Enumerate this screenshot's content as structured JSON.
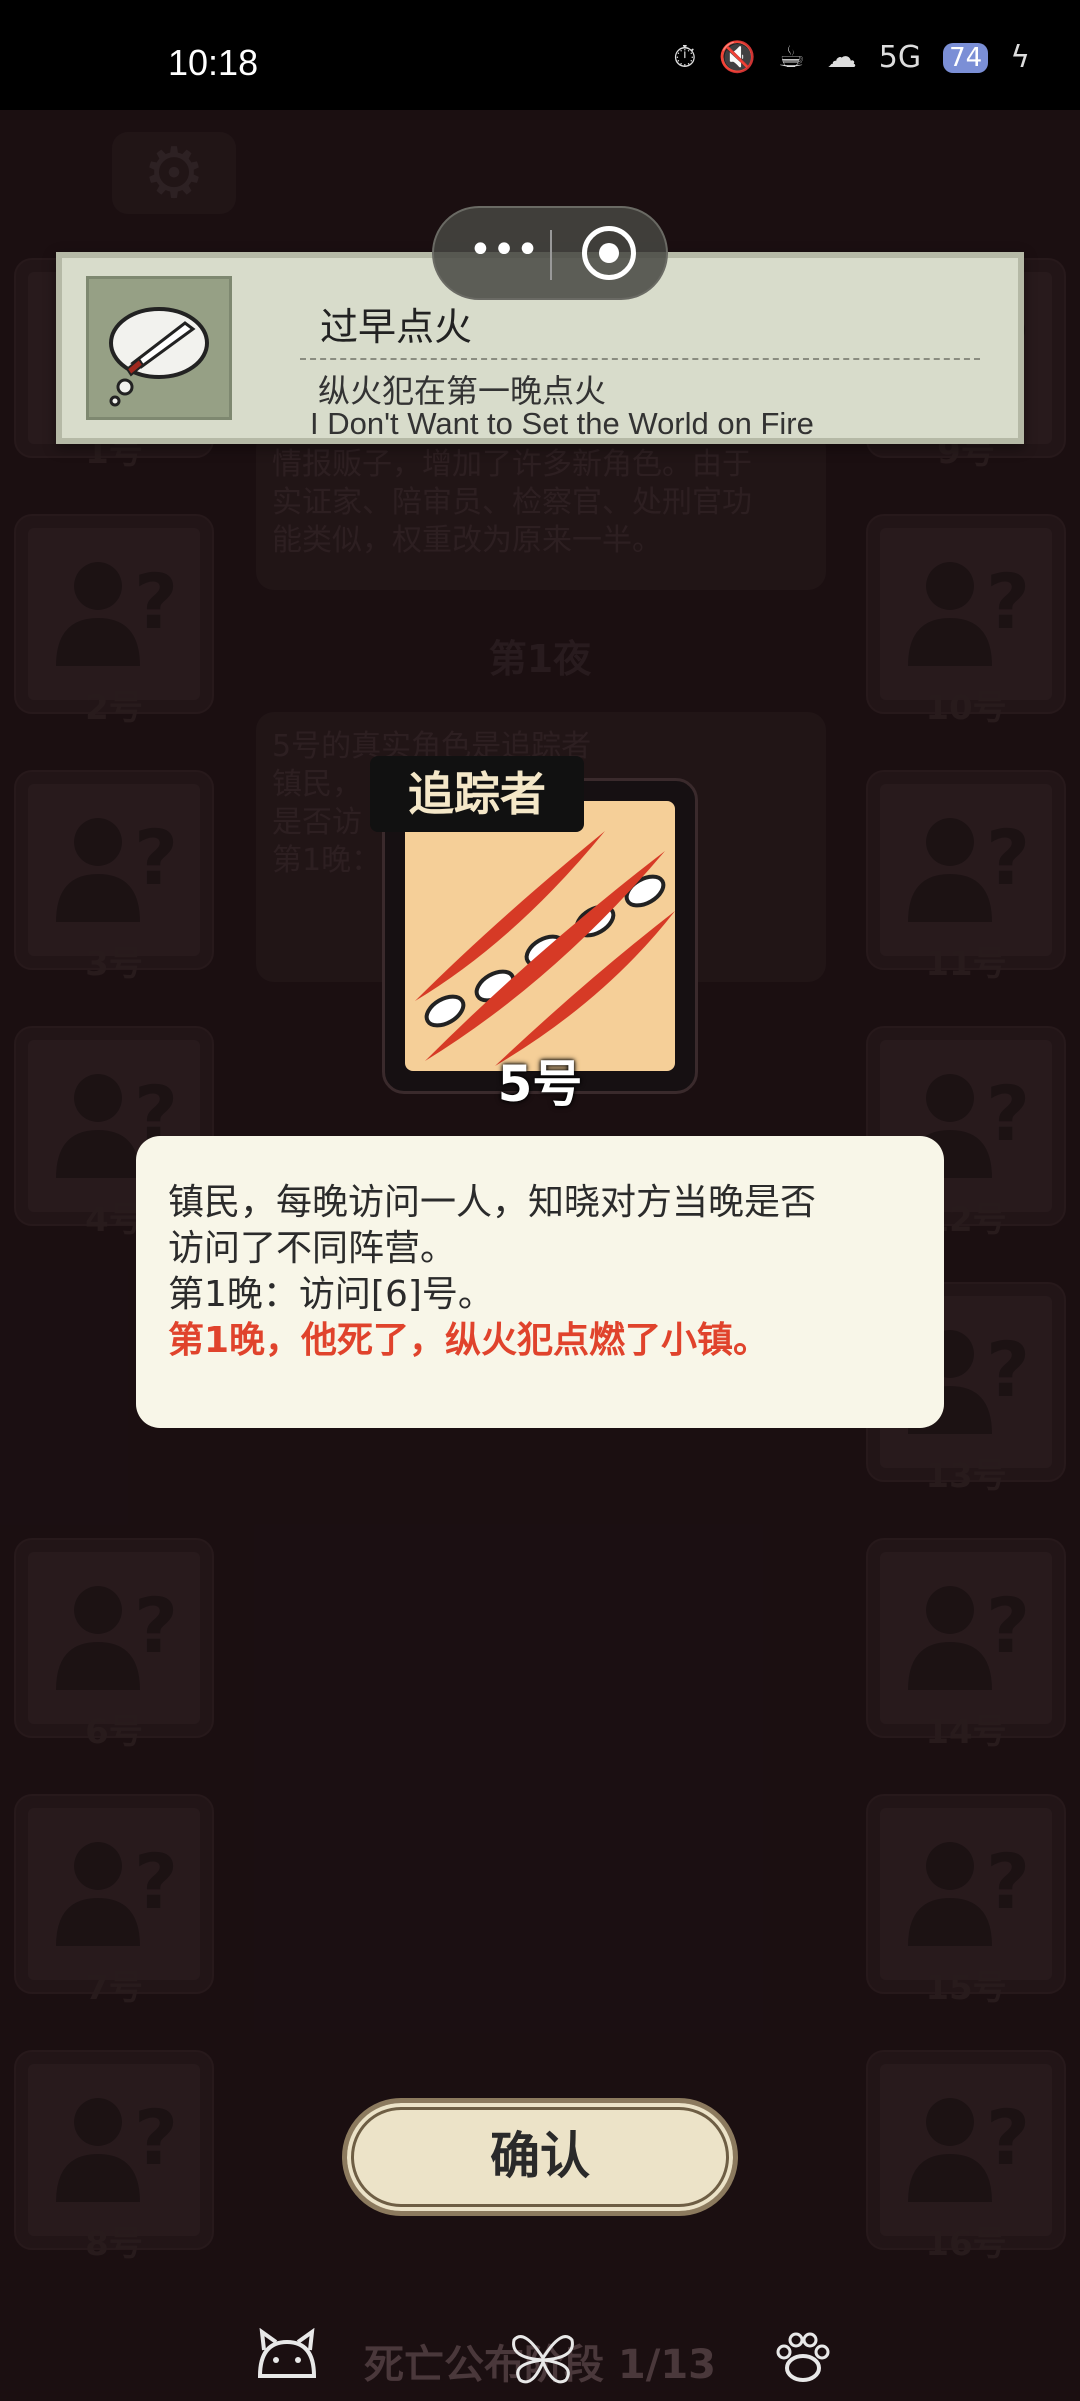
{
  "status_bar": {
    "time": "10:18",
    "icons": [
      "timer-icon",
      "mute-icon",
      "cup-icon",
      "hd-icon",
      "signal-5g-icon",
      "battery-badge-icon",
      "charging-icon"
    ],
    "network": "5G",
    "battery_badge": "74"
  },
  "players": [
    {
      "label": "1号"
    },
    {
      "label": "2号"
    },
    {
      "label": "3号"
    },
    {
      "label": "4号"
    },
    {
      "label": "6号"
    },
    {
      "label": "7号"
    },
    {
      "label": "8号"
    },
    {
      "label": "9号"
    },
    {
      "label": "10号"
    },
    {
      "label": "11号"
    },
    {
      "label": "12号"
    },
    {
      "label": "13号"
    },
    {
      "label": "14号"
    },
    {
      "label": "15号"
    },
    {
      "label": "16号"
    }
  ],
  "background_log": {
    "intro_lines": [
      "情报贩子，增加了许多新角色。由于",
      "实证家、陪审员、检察官、处刑官功",
      "能类似，权重改为原来一半。"
    ],
    "night_title": "第1夜",
    "entry_lines": [
      "5号的真实角色是追踪者",
      "镇民，",
      "是否访",
      "第1晚："
    ]
  },
  "achievement": {
    "title": "过早点火",
    "description": "纵火犯在第一晚点火",
    "english": "I Don't Want to Set the World on Fire"
  },
  "capsule": {
    "more_label": "•••"
  },
  "role_card": {
    "name": "追踪者",
    "number": "5号"
  },
  "role_description": {
    "line1": "镇民，每晚访问一人，知晓对方当晚是否",
    "line2": "访问了不同阵营。",
    "line3": "第1晚：访问[6]号。",
    "line4": "第1晚，他死了，纵火犯点燃了小镇。"
  },
  "confirm_button": {
    "label": "确认"
  },
  "bottom_bar": {
    "phase_label": "死亡公布阶段 1/13",
    "nav_icons": [
      "cat-icon",
      "butterfly-icon",
      "paw-icon"
    ]
  },
  "colors": {
    "background": "#1a0f12",
    "card": "#f8f6e8",
    "highlight_red": "#e0432c",
    "achievement_bg": "#d8dccb"
  }
}
